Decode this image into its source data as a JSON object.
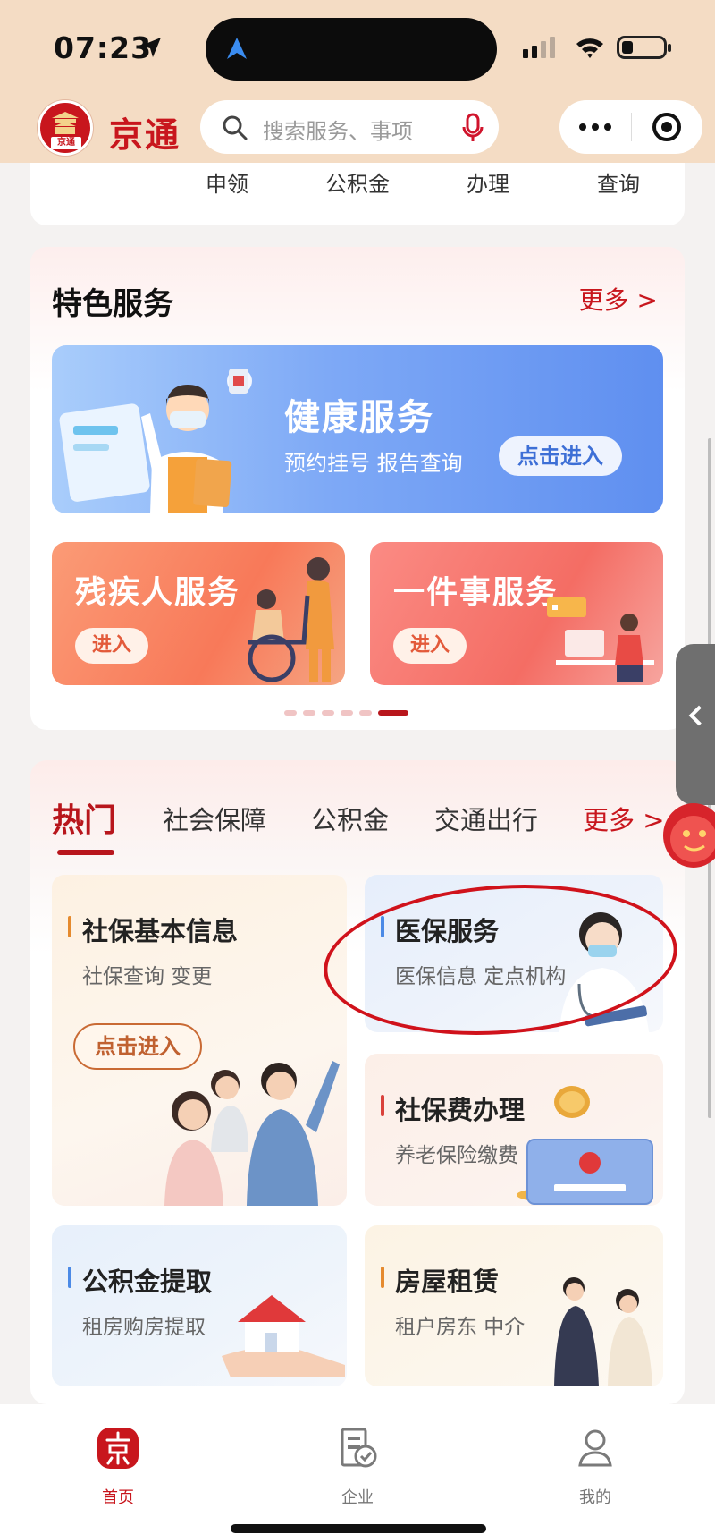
{
  "status_bar": {
    "time": "07:23"
  },
  "header": {
    "logo_text": "京通",
    "app_name": "京通",
    "search_placeholder": "搜索服务、事项"
  },
  "top_card": {
    "items": [
      "申领",
      "公积金",
      "办理",
      "查询"
    ]
  },
  "featured": {
    "title": "特色服务",
    "more": "更多 >",
    "health": {
      "title": "健康服务",
      "subtitle": "预约挂号 报告查询",
      "button": "点击进入"
    },
    "cards": [
      {
        "title": "残疾人服务",
        "button": "进入"
      },
      {
        "title": "一件事服务",
        "button": "进入"
      }
    ],
    "pager": {
      "total": 6,
      "active": 6
    }
  },
  "hot": {
    "tabs": [
      "热门",
      "社会保障",
      "公积金",
      "交通出行"
    ],
    "more": "更多 >",
    "services": [
      {
        "title": "社保基本信息",
        "subtitle": "社保查询 变更",
        "button": "点击进入"
      },
      {
        "title": "医保服务",
        "subtitle": "医保信息 定点机构"
      },
      {
        "title": "社保费办理",
        "subtitle": "养老保险缴费"
      },
      {
        "title": "公积金提取",
        "subtitle": "租房购房提取"
      },
      {
        "title": "房屋租赁",
        "subtitle": "租户房东 中介"
      }
    ]
  },
  "bottom_nav": [
    {
      "label": "首页",
      "active": true,
      "icon": "home-jing-icon"
    },
    {
      "label": "企业",
      "active": false,
      "icon": "enterprise-icon"
    },
    {
      "label": "我的",
      "active": false,
      "icon": "person-icon"
    }
  ],
  "colors": {
    "brand_red": "#c8161d",
    "header_bg": "#f4dcc4",
    "health_blue": "#6f9cf3"
  }
}
